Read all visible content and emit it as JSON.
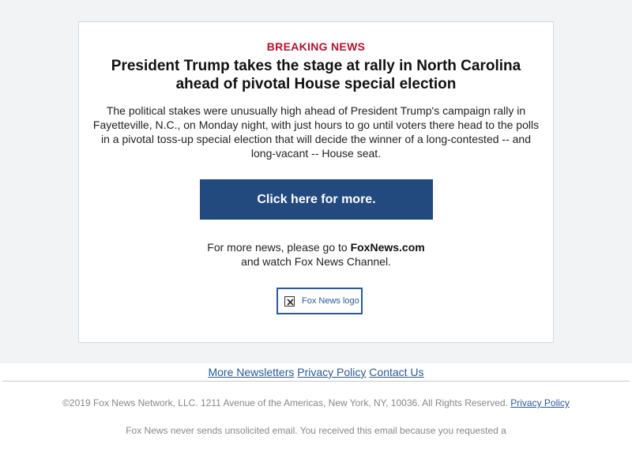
{
  "alert": {
    "label": "BREAKING NEWS",
    "headline": "President Trump takes the stage at rally in North Carolina ahead of pivotal House special election",
    "body": "The political stakes were unusually high ahead of President Trump's campaign rally in Fayetteville, N.C., on Monday night, with just hours to go until voters there head to the polls in a pivotal toss-up special election that will decide the winner of a long-contested -- and long-vacant -- House seat.",
    "cta_label": "Click here for more."
  },
  "more_news": {
    "prefix": "For more news, please go to ",
    "site": "FoxNews.com",
    "suffix": "and watch Fox News Channel."
  },
  "logo": {
    "alt_text": "Fox News logo",
    "icon": "broken-image-icon"
  },
  "footer": {
    "links": [
      "More Newsletters",
      "Privacy Policy",
      "Contact Us"
    ],
    "copyright": "©2019 Fox News Network, LLC. 1211 Avenue of the Americas, New York, NY, 10036. All Rights Reserved.",
    "copyright_link": "Privacy Policy",
    "unsolicited": "Fox News never sends unsolicited email. You received this email because you requested a"
  },
  "colors": {
    "breaking_red": "#b3132b",
    "cta_blue": "#234a7e",
    "link_blue": "#2a5a93",
    "page_bg": "#f1f3f5"
  }
}
